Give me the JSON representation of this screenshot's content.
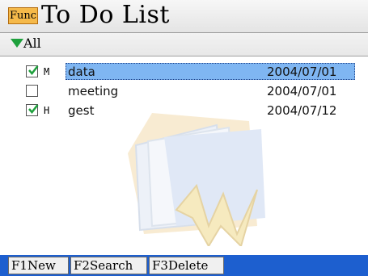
{
  "header": {
    "func_label": "Func",
    "title": "To Do List"
  },
  "filter": {
    "label": "All"
  },
  "tasks": [
    {
      "checked": true,
      "priority": "M",
      "name": "data",
      "date": "2004/07/01",
      "selected": true
    },
    {
      "checked": false,
      "priority": "",
      "name": "meeting",
      "date": "2004/07/01",
      "selected": false
    },
    {
      "checked": true,
      "priority": "H",
      "name": "gest",
      "date": "2004/07/12",
      "selected": false
    }
  ],
  "footer": {
    "f1": "F1New",
    "f2": "F2Search",
    "f3": "F3Delete"
  },
  "colors": {
    "selection": "#7fb6f2",
    "footer_bar": "#1d5fcf",
    "func_button": "#f5b94a",
    "check": "#1ea03c"
  }
}
